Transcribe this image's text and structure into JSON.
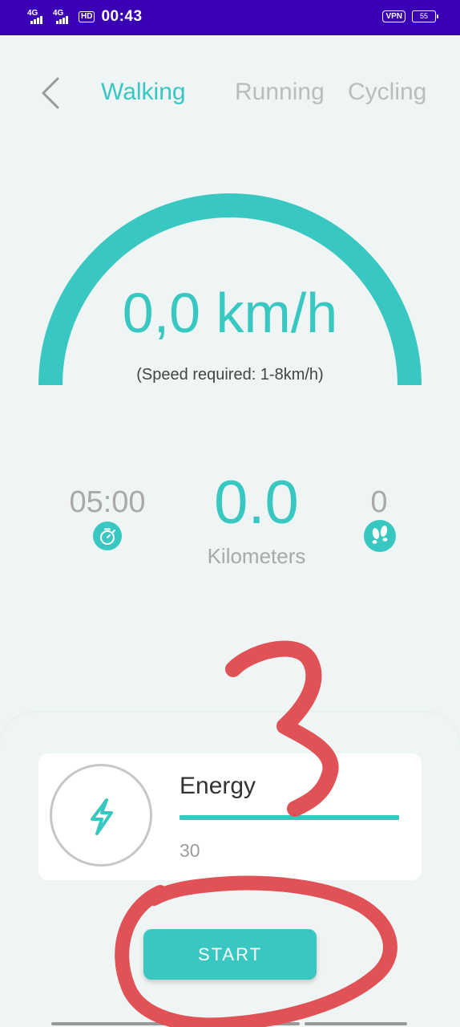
{
  "status_bar": {
    "network_1": "4G",
    "network_2": "4G",
    "hd": "HD",
    "time": "00:43",
    "vpn": "VPN",
    "battery": "55"
  },
  "tabs": [
    {
      "label": "Walking",
      "active": true
    },
    {
      "label": "Running",
      "active": false
    },
    {
      "label": "Cycling",
      "active": false
    }
  ],
  "speed": {
    "value": "0,0 km/h",
    "requirement": "(Speed required: 1-8km/h)"
  },
  "stats": {
    "time": "05:00",
    "distance": "0.0",
    "distance_label": "Kilometers",
    "steps": "0"
  },
  "energy": {
    "title": "Energy",
    "value": "30",
    "fill_fraction": 1.0
  },
  "start_button": "START",
  "colors": {
    "accent": "#38c7c1",
    "status_bar": "#3a00b4",
    "background": "#eef5f4",
    "annotation": "#e05256"
  },
  "icons": {
    "back": "chevron-left-icon",
    "timer": "stopwatch-icon",
    "steps": "footprints-icon",
    "energy": "lightning-bolt-icon"
  }
}
